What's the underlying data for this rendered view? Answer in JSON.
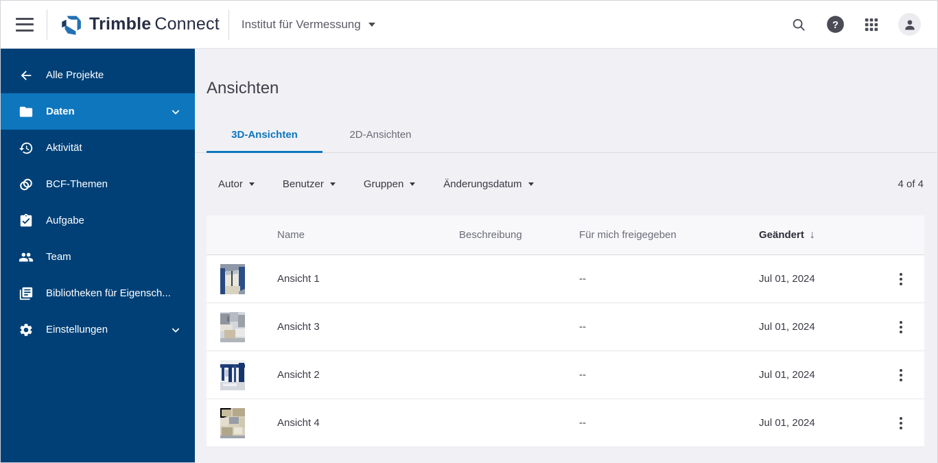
{
  "colors": {
    "sidebar_bg": "#004077",
    "sidebar_active_bg": "#0d76bd",
    "accent_blue": "#0d76bd",
    "brand_navy": "#272c44",
    "page_bg": "#f1f1f5"
  },
  "icons": {
    "menu": "hamburger-3-lines",
    "search": "magnifier",
    "help": "filled-circle-question-mark",
    "apps": "3x3-grid",
    "account": "person-in-circle",
    "back": "arrow-left",
    "daten": "folder",
    "aktivitaet": "history-clock",
    "bcf": "overlapping-rings",
    "aufgabe": "clipboard-check",
    "team": "two-people",
    "bibliotheken": "library-books",
    "einstellungen": "gear",
    "expand": "chevron-down",
    "row_menu": "kebab-3-dots",
    "sort": "arrow-down"
  },
  "header": {
    "brand_bold": "Trimble",
    "brand_light": "Connect",
    "project_selector": "Institut für Vermessung"
  },
  "sidebar": {
    "items": [
      {
        "label": "Alle Projekte"
      },
      {
        "label": "Daten",
        "active": true
      },
      {
        "label": "Aktivität"
      },
      {
        "label": "BCF-Themen"
      },
      {
        "label": "Aufgabe"
      },
      {
        "label": "Team"
      },
      {
        "label": "Bibliotheken für Eigensch..."
      },
      {
        "label": "Einstellungen"
      }
    ]
  },
  "main": {
    "title": "Ansichten",
    "tabs": [
      {
        "label": "3D-Ansichten",
        "active": true
      },
      {
        "label": "2D-Ansichten",
        "active": false
      }
    ],
    "filters": [
      {
        "label": "Autor"
      },
      {
        "label": "Benutzer"
      },
      {
        "label": "Gruppen"
      },
      {
        "label": "Änderungsdatum"
      }
    ],
    "result_count": "4 of 4",
    "table": {
      "columns": [
        "Name",
        "Beschreibung",
        "Für mich freigegeben",
        "Geändert"
      ],
      "sorted_column": "Geändert",
      "sort_direction": "desc",
      "rows": [
        {
          "name": "Ansicht 1",
          "beschreibung": "",
          "freigegeben": "--",
          "geaendert": "Jul 01, 2024"
        },
        {
          "name": "Ansicht 3",
          "beschreibung": "",
          "freigegeben": "--",
          "geaendert": "Jul 01, 2024"
        },
        {
          "name": "Ansicht 2",
          "beschreibung": "",
          "freigegeben": "--",
          "geaendert": "Jul 01, 2024"
        },
        {
          "name": "Ansicht 4",
          "beschreibung": "",
          "freigegeben": "--",
          "geaendert": "Jul 01, 2024"
        }
      ]
    }
  }
}
